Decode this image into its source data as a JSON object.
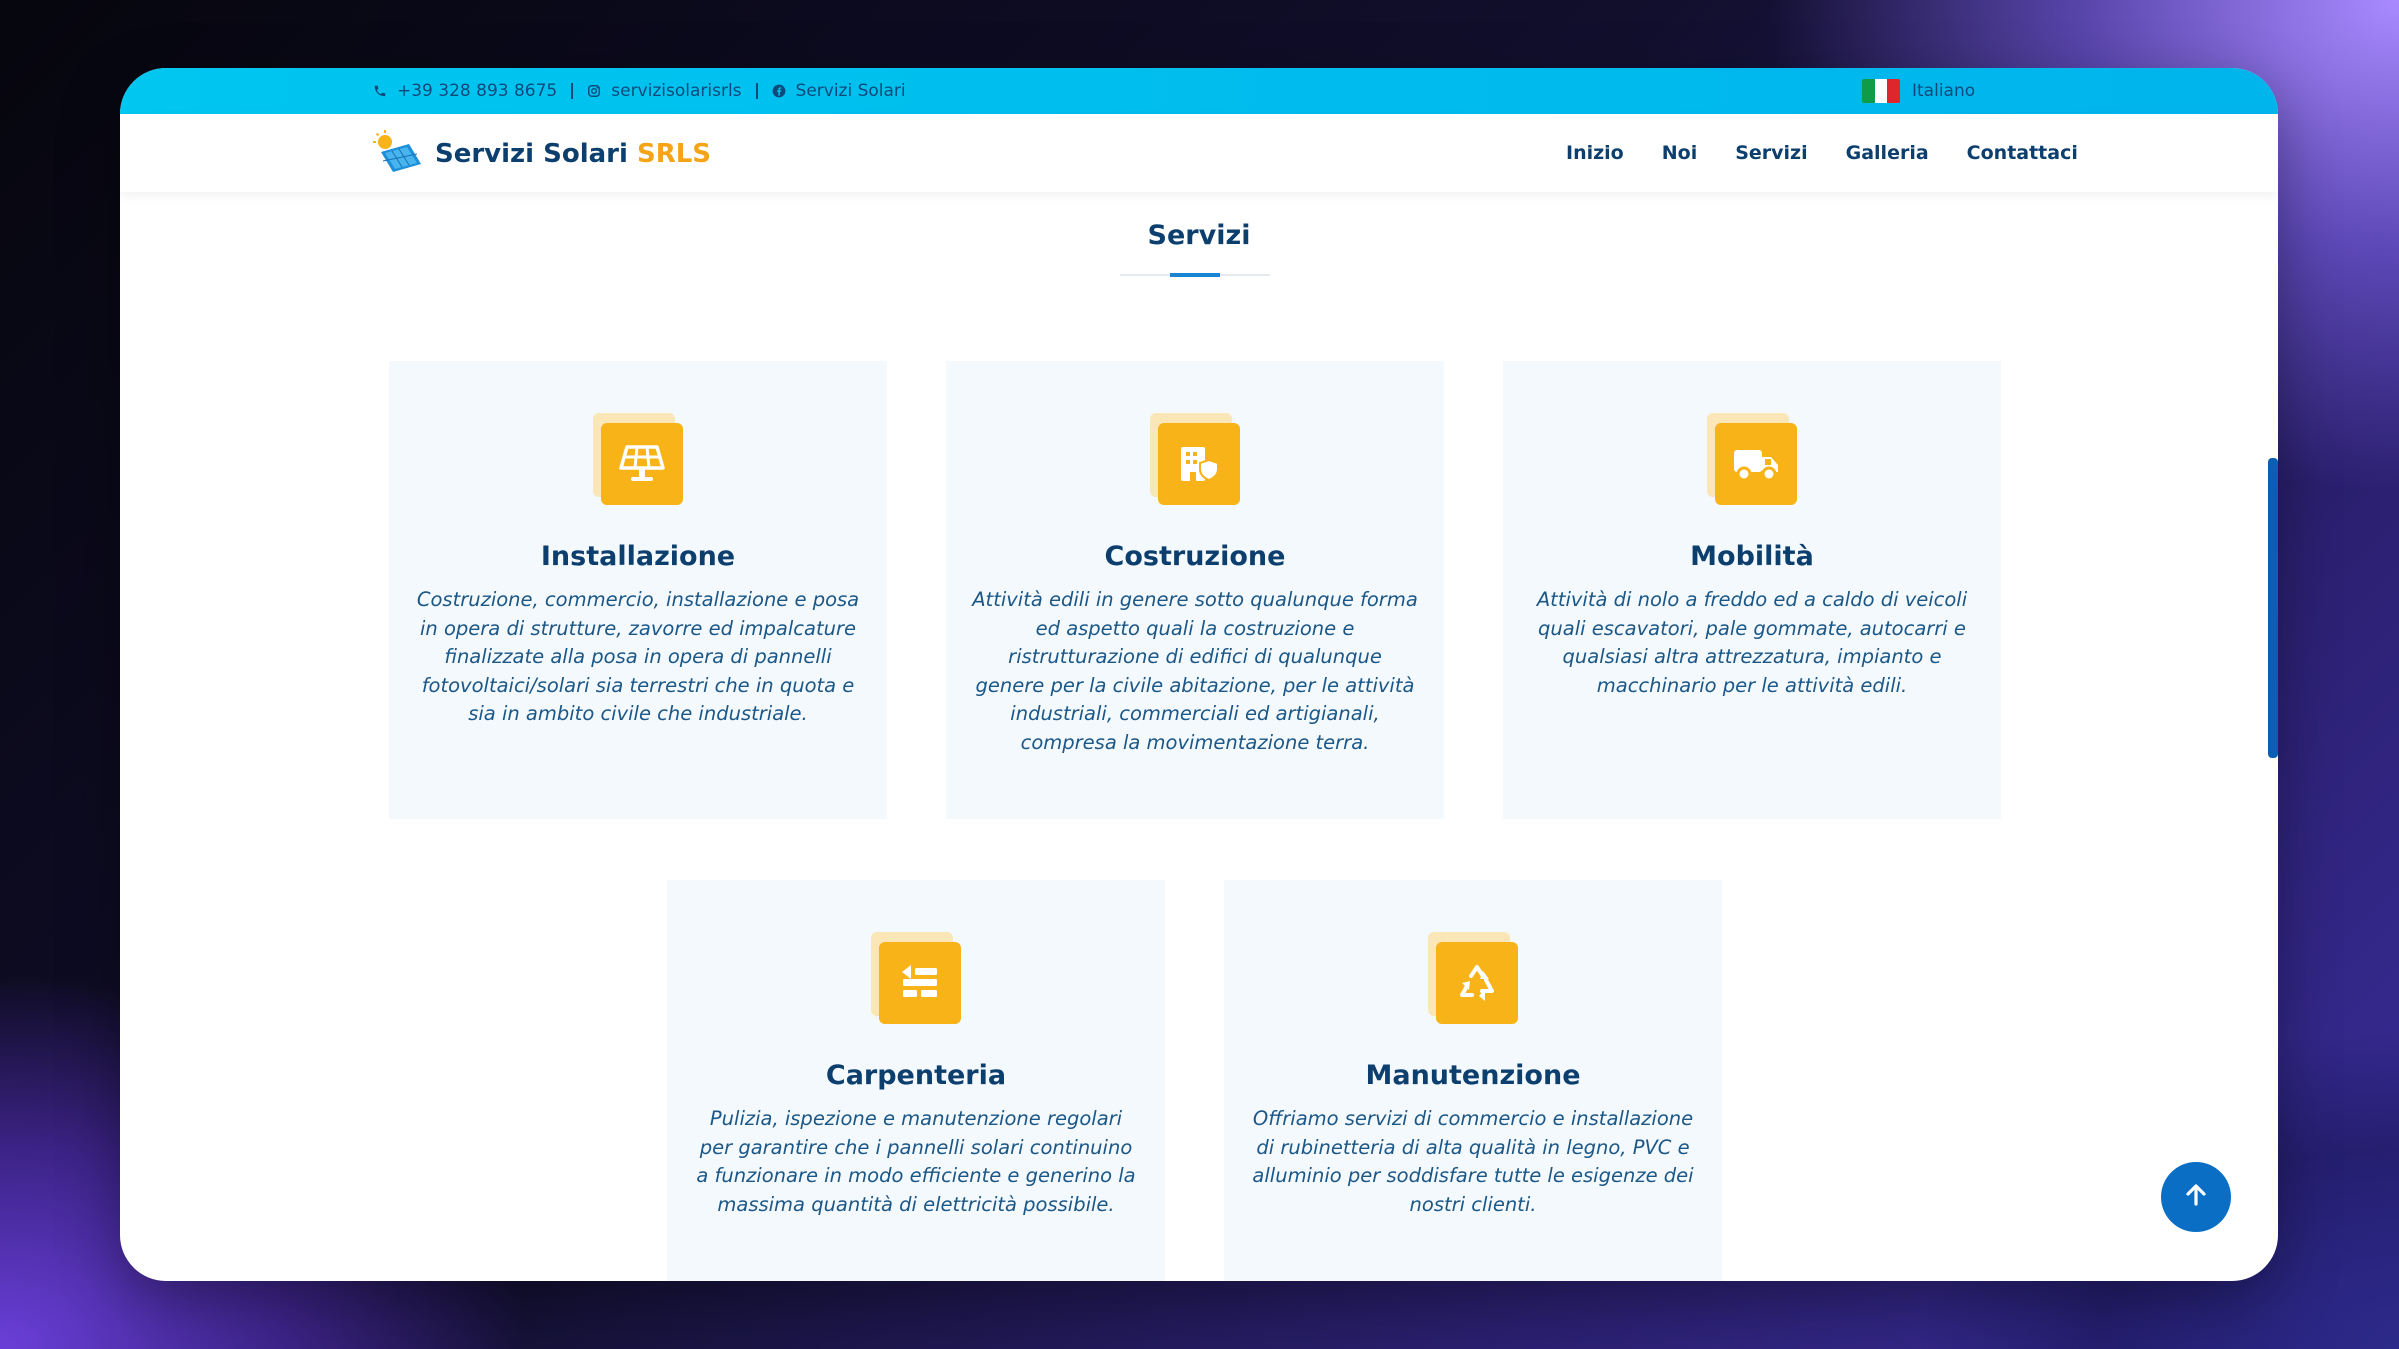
{
  "topbar": {
    "phone": "+39 328 893 8675",
    "instagram": "servizisolarisrls",
    "facebook": "Servizi Solari",
    "language": "Italiano"
  },
  "brand": {
    "name": "Servizi Solari",
    "suffix": "SRLS"
  },
  "nav": {
    "items": [
      "Inizio",
      "Noi",
      "Servizi",
      "Galleria",
      "Contattaci"
    ]
  },
  "section": {
    "title": "Servizi"
  },
  "services": [
    {
      "icon": "solar-panel-icon",
      "title": "Installazione",
      "description": "Costruzione, commercio, installazione e posa in opera di strutture, zavorre ed impalcature finalizzate alla posa in opera di pannelli fotovoltaici/solari sia terrestri che in quota e sia in ambito civile che industriale."
    },
    {
      "icon": "building-shield-icon",
      "title": "Costruzione",
      "description": "Attività edili in genere sotto qualunque forma ed aspetto quali la costruzione e ristrutturazione di edifici di qualunque genere per la civile abitazione, per le attività industriali, commerciali ed artigianali, compresa la movimentazione terra."
    },
    {
      "icon": "truck-icon",
      "title": "Mobilità",
      "description": "Attività di nolo a freddo ed a caldo di veicoli quali escavatori, pale gommate, autocarri e qualsiasi altra attrezzatura, impianto e macchinario per le attività edili."
    },
    {
      "icon": "tools-icon",
      "title": "Carpenteria",
      "description": "Pulizia, ispezione e manutenzione regolari per garantire che i pannelli solari continuino a funzionare in modo efficiente e generino la massima quantità di elettricità possibile."
    },
    {
      "icon": "recycle-icon",
      "title": "Manutenzione",
      "description": "Offriamo servizi di commercio e installazione di rubinetteria di alta qualità in legno, PVC e alluminio per soddisfare tutte le esigenze dei nostri clienti."
    }
  ],
  "colors": {
    "primary": "#0d3f6e",
    "accent": "#f7b318",
    "topbar": "#00c0ef",
    "card_bg": "#f4f9fd",
    "button": "#0a6fc4"
  }
}
